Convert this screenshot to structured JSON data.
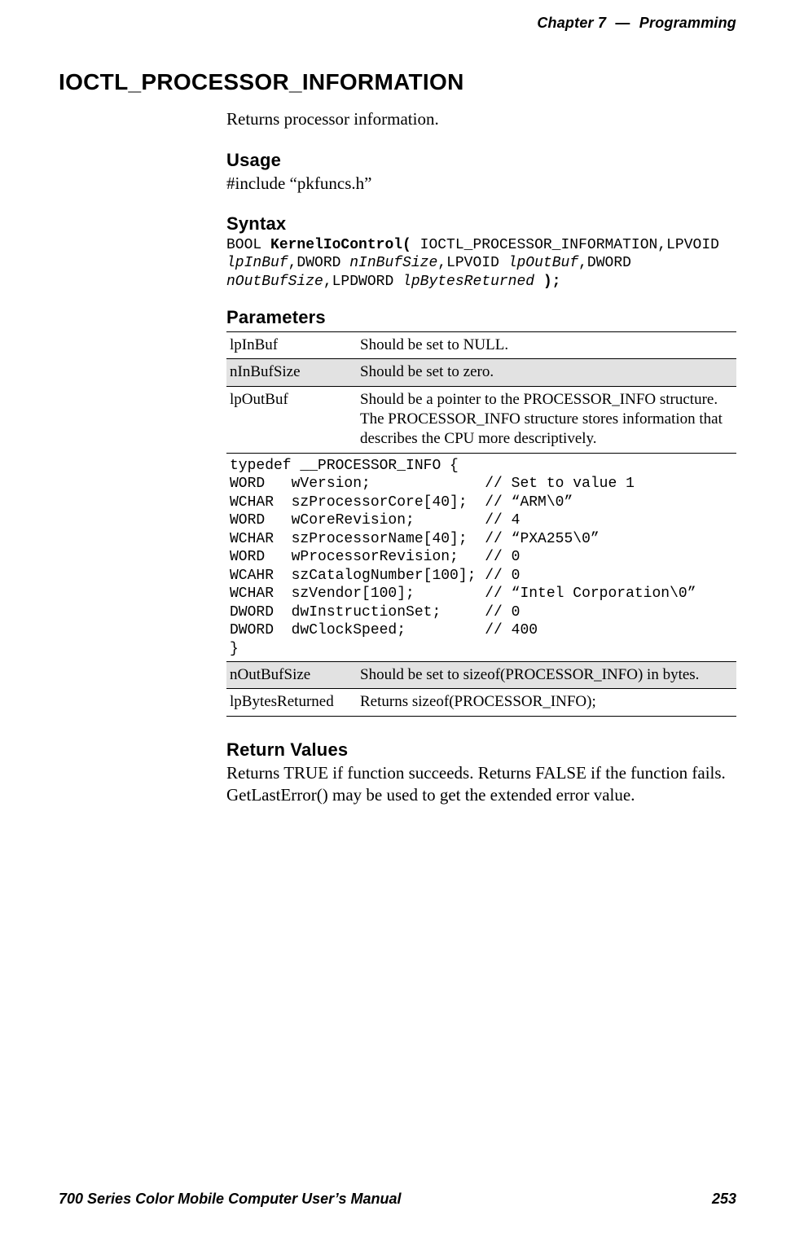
{
  "header": {
    "chapter_label": "Chapter",
    "chapter_number": "7",
    "dash": "—",
    "chapter_title": "Programming"
  },
  "topic": {
    "title": "IOCTL_PROCESSOR_INFORMATION",
    "intro": "Returns processor information."
  },
  "usage": {
    "heading": "Usage",
    "text": "#include “pkfuncs.h”"
  },
  "syntax": {
    "heading": "Syntax",
    "tokens": {
      "t1": "BOOL ",
      "t2": "KernelIoControl( ",
      "t3": "IOCTL_PROCESSOR_INFORMATION,LPVOID ",
      "t4": "lpInBuf",
      "t5": ",DWORD ",
      "t6": "nInBufSize",
      "t7": ",LPVOID ",
      "t8": "lpOutBuf",
      "t9": ",DWORD ",
      "t10": "nOutBufSize",
      "t11": ",LPDWORD ",
      "t12": "lpBytesReturned",
      "t13": " );"
    }
  },
  "parameters": {
    "heading": "Parameters",
    "rows": [
      {
        "name": "lpInBuf",
        "desc": "Should be set to NULL."
      },
      {
        "name": "nInBufSize",
        "desc": "Should be set to zero."
      },
      {
        "name": "lpOutBuf",
        "desc": "Should be a pointer to the PROCESSOR_INFO structure. The PROCESSOR_INFO structure stores information that describes the CPU more descriptively."
      }
    ],
    "code": "typedef __PROCESSOR_INFO {\nWORD   wVersion;             // Set to value 1\nWCHAR  szProcessorCore[40];  // “ARM\\0”\nWORD   wCoreRevision;        // 4\nWCHAR  szProcessorName[40];  // “PXA255\\0”\nWORD   wProcessorRevision;   // 0\nWCAHR  szCatalogNumber[100]; // 0\nWCHAR  szVendor[100];        // “Intel Corporation\\0”\nDWORD  dwInstructionSet;     // 0\nDWORD  dwClockSpeed;         // 400\n}",
    "rows_after": [
      {
        "name": "nOutBufSize",
        "desc": "Should be set to sizeof(PROCESSOR_INFO) in bytes."
      },
      {
        "name": "lpBytesReturned",
        "desc": "Returns sizeof(PROCESSOR_INFO);"
      }
    ]
  },
  "return_values": {
    "heading": "Return Values",
    "text": "Returns TRUE if function succeeds. Returns FALSE if the function fails. GetLastError() may be used to get the extended error value."
  },
  "footer": {
    "manual_title": "700 Series Color Mobile Computer User’s Manual",
    "page_number": "253"
  }
}
